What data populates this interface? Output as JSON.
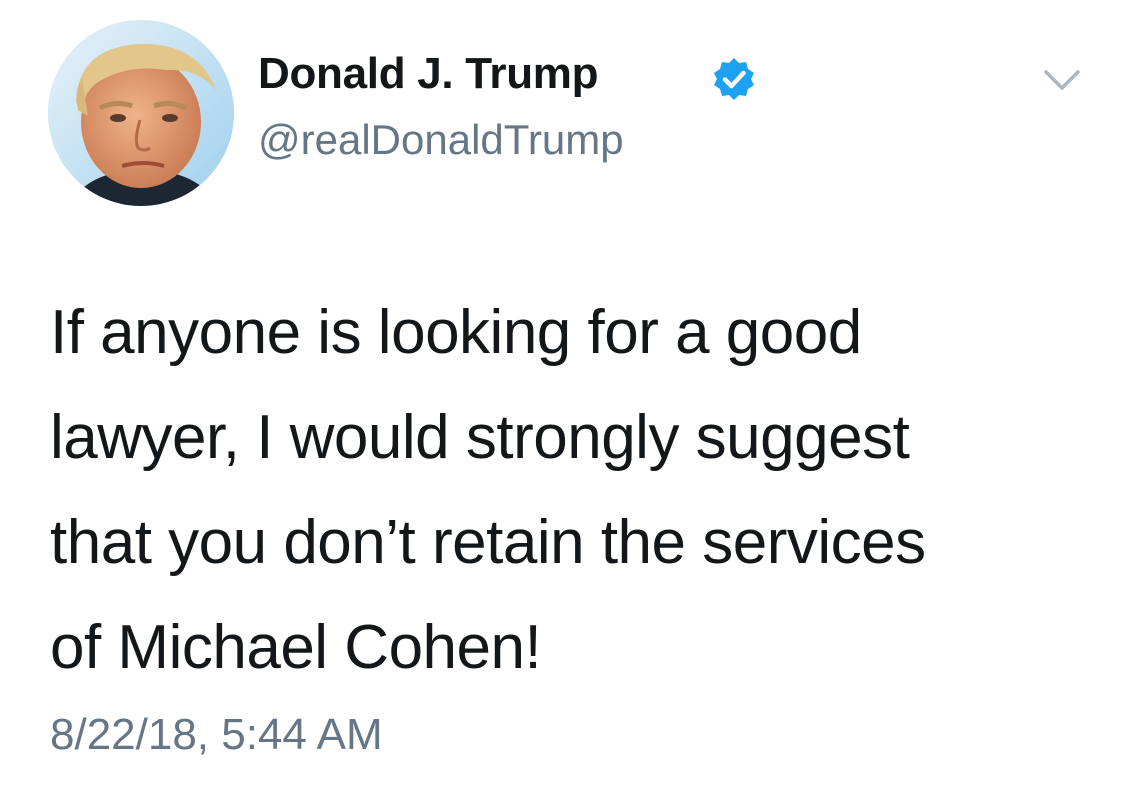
{
  "author": {
    "display_name": "Donald J. Trump",
    "handle": "@realDonaldTrump",
    "verified": true,
    "avatar_icon": "profile-photo"
  },
  "tweet": {
    "text_lines": [
      "If anyone is looking for a good",
      "lawyer, I would strongly suggest",
      "that you don’t retain the services",
      "of Michael Cohen!"
    ],
    "timestamp": "8/22/18, 5:44 AM"
  },
  "icons": {
    "verified": "verified-badge-icon",
    "menu": "chevron-down-icon"
  },
  "colors": {
    "text": "#14171a",
    "secondary": "#657786",
    "verified_blue": "#1da1f2",
    "caret": "#aab8c2"
  }
}
